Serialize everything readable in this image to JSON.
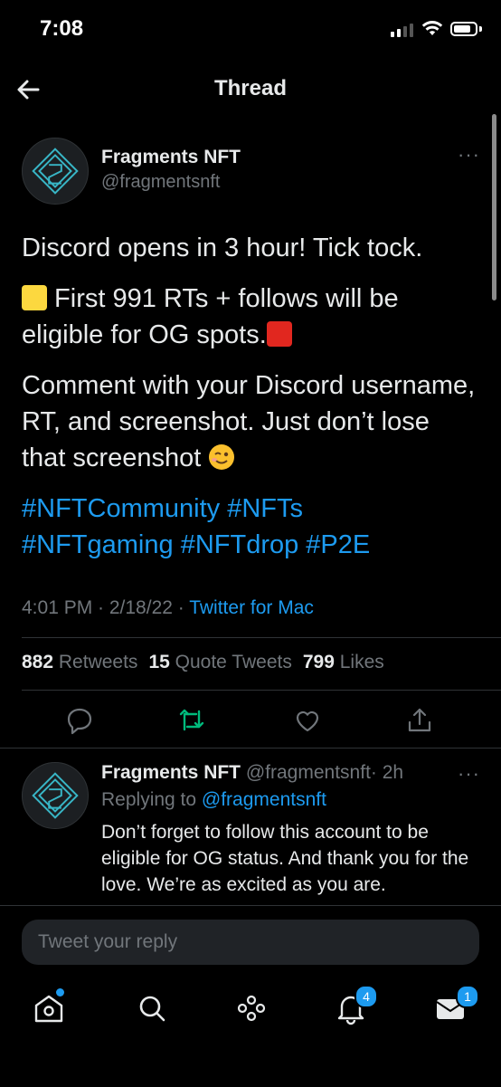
{
  "status_bar": {
    "time": "7:08"
  },
  "header": {
    "title": "Thread"
  },
  "tweet": {
    "author_name": "Fragments NFT",
    "author_handle": "@fragmentsnft",
    "line1": "Discord opens in 3 hour! Tick tock.",
    "line2_a": " First 991 RTs + follows will be eligible for OG spots.",
    "line3": "Comment with your Discord username, RT, and screenshot. Just don’t lose that screenshot ",
    "hashtags": [
      "#NFTCommunity",
      "#NFTs",
      "#NFTgaming",
      "#NFTdrop",
      "#P2E"
    ],
    "timestamp": "4:01 PM · 2/18/22 · ",
    "source": "Twitter for Mac",
    "retweets_count": "882",
    "retweets_label": "Retweets",
    "quotes_count": "15",
    "quotes_label": "Quote Tweets",
    "likes_count": "799",
    "likes_label": "Likes"
  },
  "reply": {
    "author_name": "Fragments NFT",
    "author_handle": "@fragmentsnft",
    "time_ago": "· 2h",
    "replying_prefix": "Replying to ",
    "replying_handle": "@fragmentsnft",
    "text": "Don’t forget to follow this account to be eligible for OG status. And thank you for the love. We’re as excited as you are."
  },
  "composer": {
    "placeholder": "Tweet your reply"
  },
  "tabbar": {
    "notifications_badge": "4",
    "messages_badge": "1"
  },
  "colors": {
    "accent": "#1d9bf0",
    "retweet_green": "#00ba7c",
    "background": "#000000"
  }
}
